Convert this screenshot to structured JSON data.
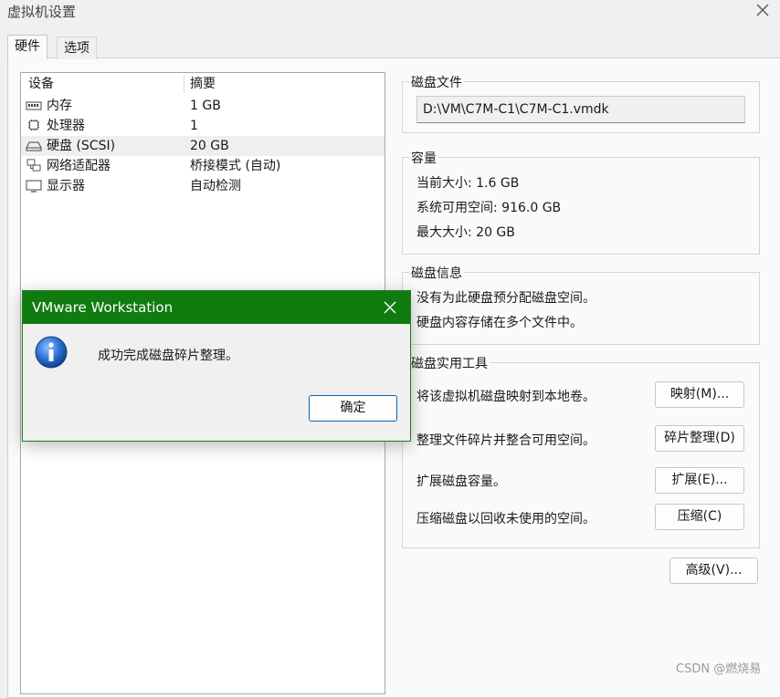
{
  "window": {
    "title": "虚拟机设置"
  },
  "tabs": [
    {
      "label": "硬件"
    },
    {
      "label": "选项"
    }
  ],
  "device_list": {
    "headers": [
      "设备",
      "摘要"
    ],
    "rows": [
      {
        "icon": "memory-icon",
        "name": "内存",
        "summary": "1 GB"
      },
      {
        "icon": "processor-icon",
        "name": "处理器",
        "summary": "1"
      },
      {
        "icon": "hard-disk-icon",
        "name": "硬盘 (SCSI)",
        "summary": "20 GB",
        "selected": true
      },
      {
        "icon": "network-adapter-icon",
        "name": "网络适配器",
        "summary": "桥接模式 (自动)"
      },
      {
        "icon": "display-icon",
        "name": "显示器",
        "summary": "自动检测"
      }
    ]
  },
  "disk_file": {
    "label": "磁盘文件",
    "path": "D:\\VM\\C7M-C1\\C7M-C1.vmdk"
  },
  "capacity": {
    "label": "容量",
    "current": "当前大小: 1.6 GB",
    "available": "系统可用空间: 916.0 GB",
    "max": "最大大小: 20 GB"
  },
  "disk_info": {
    "label": "磁盘信息",
    "line1": "没有为此硬盘预分配磁盘空间。",
    "line2": "硬盘内容存储在多个文件中。"
  },
  "disk_utilities": {
    "label": "磁盘实用工具",
    "items": [
      {
        "text": "将该虚拟机磁盘映射到本地卷。",
        "button": "映射(M)..."
      },
      {
        "text": "整理文件碎片并整合可用空间。",
        "button": "碎片整理(D)"
      },
      {
        "text": "扩展磁盘容量。",
        "button": "扩展(E)..."
      },
      {
        "text": "压缩磁盘以回收未使用的空间。",
        "button": "压缩(C)"
      }
    ]
  },
  "advanced_button": "高级(V)...",
  "dialog": {
    "title": "VMware Workstation",
    "message": "成功完成磁盘碎片整理。",
    "ok": "确定"
  },
  "watermark": "CSDN @燃烧易",
  "colors": {
    "dialog_title_bar": "#107c10",
    "ok_border": "#0067c0",
    "info_icon": "#1f5fc0"
  }
}
